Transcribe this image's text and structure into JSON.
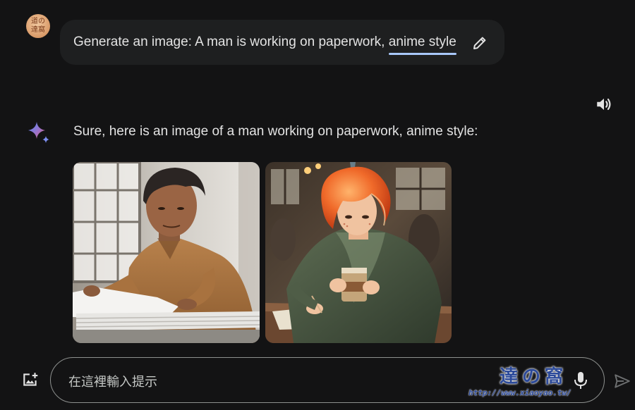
{
  "user": {
    "avatar_lines": [
      "道の",
      "達窩"
    ],
    "prompt_prefix": "Generate an image: A man is working on paperwork, ",
    "prompt_highlight": "anime style",
    "edit_icon": "pencil-icon"
  },
  "response": {
    "speaker_icon": "volume-icon",
    "assistant_icon": "sparkle-icon",
    "text": "Sure, here is an image of a man working on paperwork, anime style:",
    "images": [
      {
        "subject": "photo-man-paperwork"
      },
      {
        "subject": "anime-man-redhair-coffee"
      }
    ]
  },
  "composer": {
    "placeholder": "在這裡輸入提示",
    "add_image_icon": "add-image-icon",
    "mic_icon": "mic-icon",
    "send_icon": "send-icon"
  },
  "watermark": {
    "logo": "達の窩",
    "url": "http://www.xiaoyao.tw/"
  },
  "colors": {
    "background": "#131314",
    "bubble": "#1e1f20",
    "text": "#e3e3e3",
    "highlight_underline": "#a8c7fa",
    "input_border": "#8e918f"
  }
}
